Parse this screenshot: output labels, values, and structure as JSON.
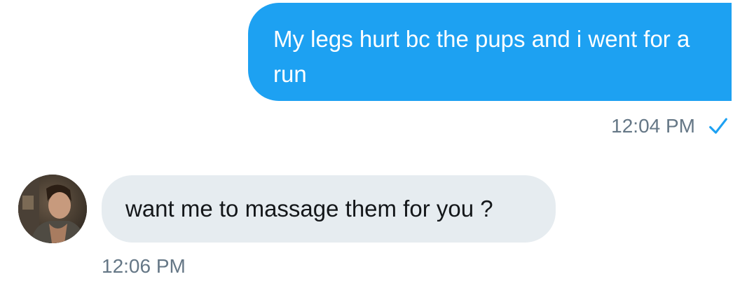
{
  "conversation": {
    "outgoing": {
      "text": "My legs hurt bc the pups and i went for a run",
      "time": "12:04 PM",
      "status_icon": "check-icon",
      "bubble_color": "#1da1f2"
    },
    "incoming": {
      "text": "want me to massage them for you ?",
      "time": "12:06 PM",
      "avatar_icon": "avatar",
      "bubble_color": "#e6ecf0"
    }
  },
  "colors": {
    "accent": "#1da1f2",
    "timestamp": "#657786",
    "incoming_text": "#14171a"
  }
}
